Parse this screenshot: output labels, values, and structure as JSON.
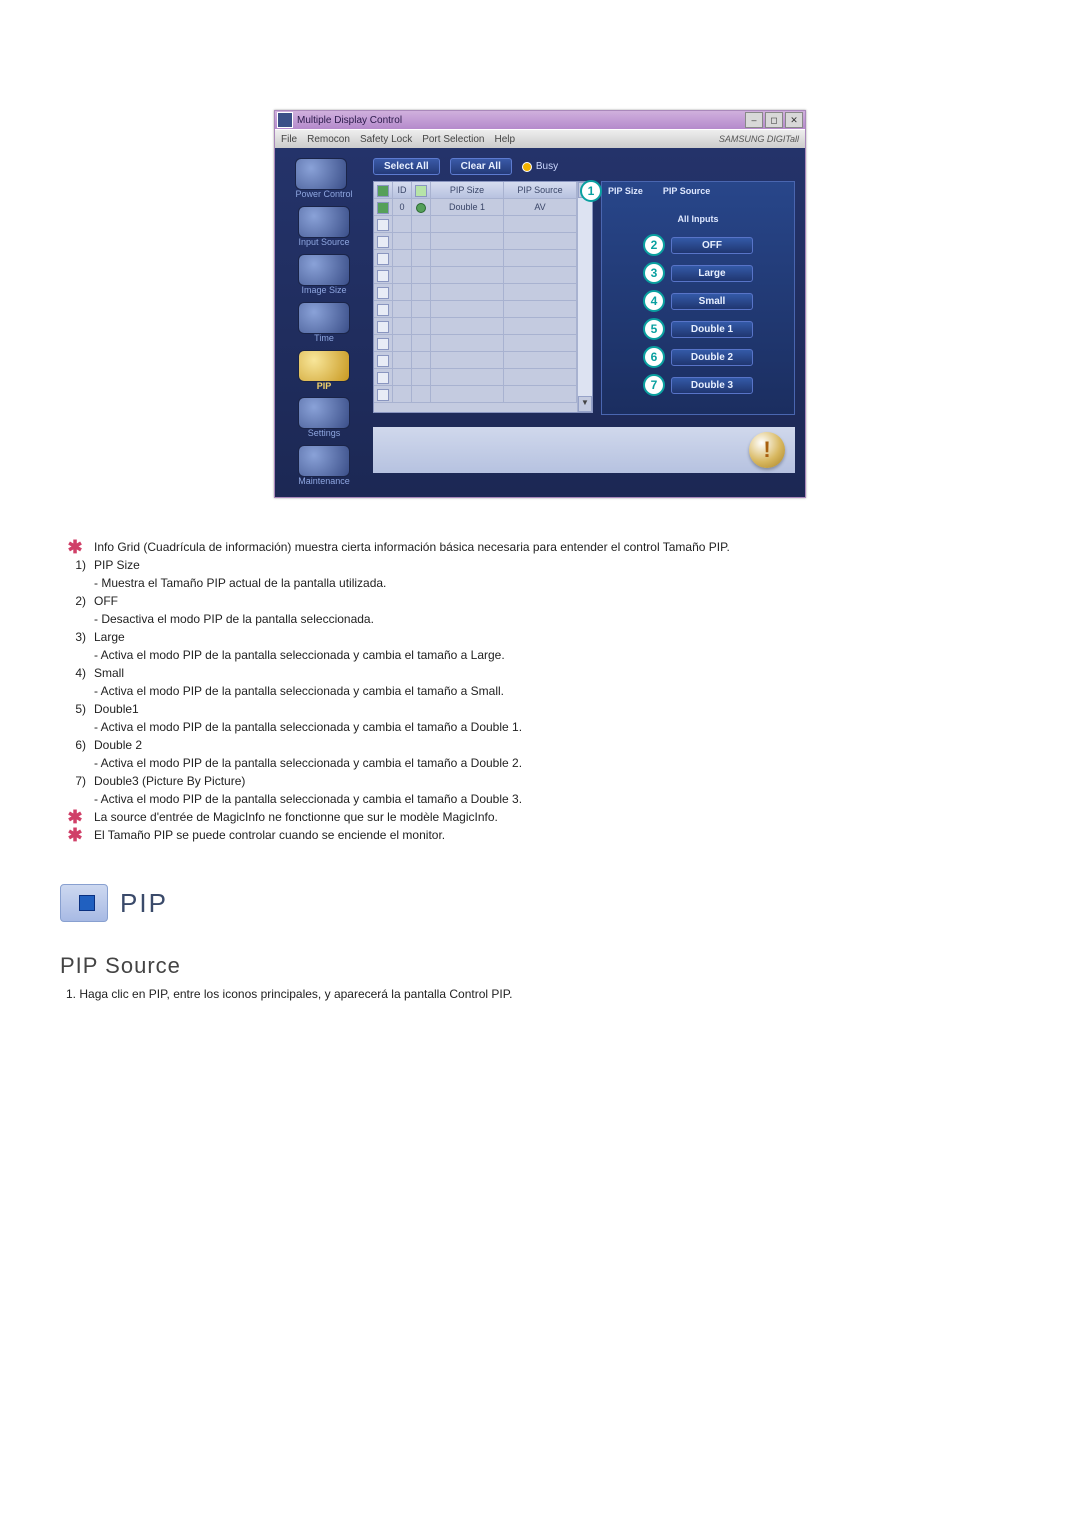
{
  "app": {
    "title": "Multiple Display Control",
    "brand": "SAMSUNG DIGITall",
    "menus": [
      "File",
      "Remocon",
      "Safety Lock",
      "Port Selection",
      "Help"
    ]
  },
  "sidebar": {
    "items": [
      {
        "label": "Power Control"
      },
      {
        "label": "Input Source"
      },
      {
        "label": "Image Size"
      },
      {
        "label": "Time"
      },
      {
        "label": "PIP",
        "active": true
      },
      {
        "label": "Settings"
      },
      {
        "label": "Maintenance"
      }
    ]
  },
  "toolbar": {
    "select_all": "Select All",
    "clear_all": "Clear All",
    "busy": "Busy"
  },
  "grid": {
    "headers": {
      "c1": "",
      "c2": "ID",
      "c3": "",
      "c4": "PIP Size",
      "c5": "PIP Source"
    },
    "row0": {
      "id": "0",
      "c4": "Double 1",
      "c5": "AV"
    }
  },
  "panel": {
    "h1": "PIP Size",
    "h2": "PIP Source",
    "sub": "All Inputs",
    "opts": [
      "OFF",
      "Large",
      "Small",
      "Double 1",
      "Double 2",
      "Double 3"
    ]
  },
  "callouts": [
    "1",
    "2",
    "3",
    "4",
    "5",
    "6",
    "7"
  ],
  "doc": {
    "star_line": "Info Grid (Cuadrícula de información) muestra cierta información básica necesaria para entender el control Tamaño PIP.",
    "items": [
      {
        "n": "1)",
        "t": "PIP Size",
        "s": "- Muestra el Tamaño PIP actual de la pantalla utilizada."
      },
      {
        "n": "2)",
        "t": "OFF",
        "s": "- Desactiva el modo PIP de la pantalla seleccionada."
      },
      {
        "n": "3)",
        "t": "Large",
        "s": "- Activa el modo PIP de la pantalla seleccionada y cambia el tamaño a Large."
      },
      {
        "n": "4)",
        "t": "Small",
        "s": "- Activa el modo PIP de la pantalla seleccionada y cambia el tamaño a Small."
      },
      {
        "n": "5)",
        "t": "Double1",
        "s": "- Activa el modo PIP de la pantalla seleccionada y cambia el tamaño a Double 1."
      },
      {
        "n": "6)",
        "t": "Double 2",
        "s": "- Activa el modo PIP de la pantalla seleccionada y cambia el tamaño a Double 2."
      },
      {
        "n": "7)",
        "t": "Double3 (Picture By Picture)",
        "s": "- Activa el modo PIP de la pantalla seleccionada y cambia el tamaño a Double 3."
      }
    ],
    "note1": "La source d'entrée de MagicInfo ne fonctionne que sur le modèle MagicInfo.",
    "note2": "El Tamaño PIP se puede controlar cuando se enciende el monitor.",
    "pip_label": "PIP",
    "sub_heading": "PIP Source",
    "body1_n": "1.",
    "body1_t": "Haga clic en PIP, entre los iconos principales, y aparecerá la pantalla Control PIP."
  }
}
